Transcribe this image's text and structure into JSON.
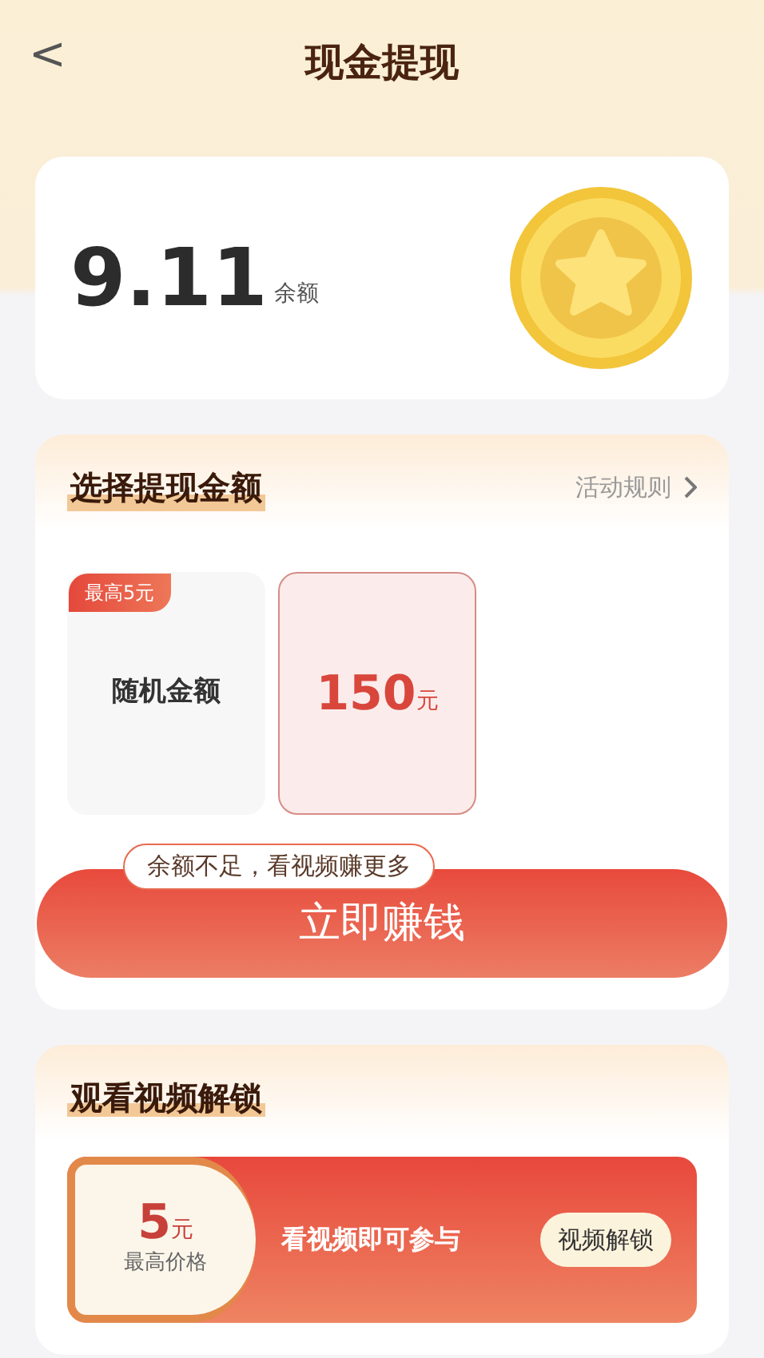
{
  "header": {
    "back": "<",
    "title": "现金提现"
  },
  "balance": {
    "amount": "9.11",
    "label": "余额"
  },
  "withdraw": {
    "title": "选择提现金额",
    "rules_link": "活动规则",
    "options": [
      {
        "label": "随机金额",
        "badge": "最高5元",
        "kind": "random",
        "selected": false
      },
      {
        "amount": "150",
        "unit": "元",
        "kind": "fixed",
        "selected": true
      }
    ],
    "tip": "余额不足，看视频赚更多",
    "button": "立即赚钱"
  },
  "unlock": {
    "title": "观看视频解锁",
    "price": "5",
    "unit": "元",
    "price_label": "最高价格",
    "text": "看视频即可参与",
    "button": "视频解锁"
  }
}
